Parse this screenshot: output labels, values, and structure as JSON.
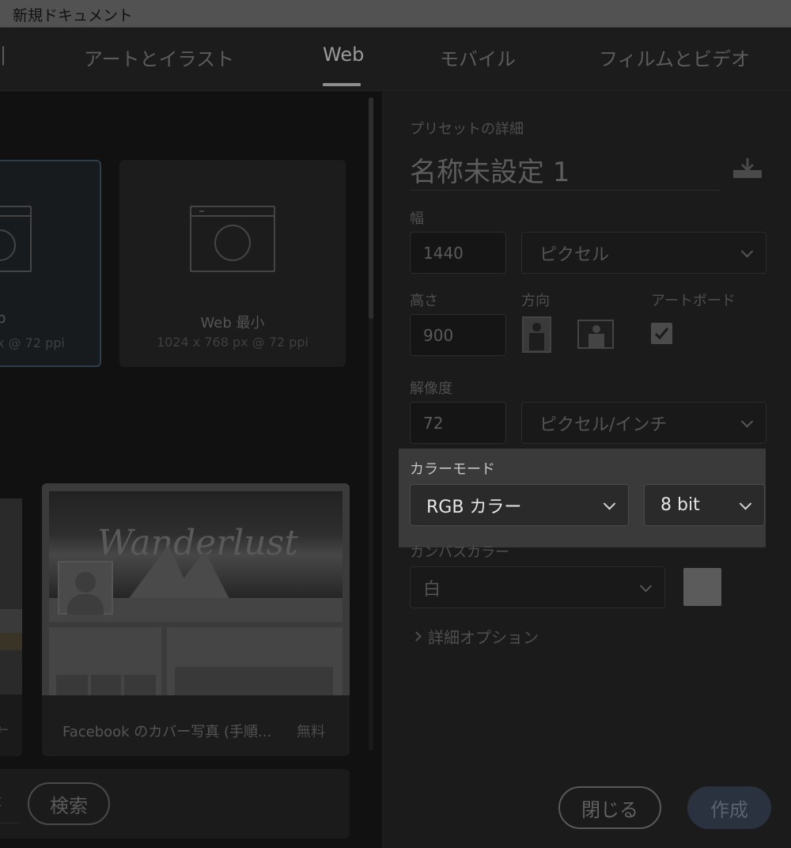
{
  "window": {
    "title": "新規ドキュメント"
  },
  "tabs": [
    {
      "label": "|"
    },
    {
      "label": "アートとイラスト"
    },
    {
      "label": "Web",
      "active": true
    },
    {
      "label": "モバイル"
    },
    {
      "label": "フィルムとビデオ"
    }
  ],
  "presets": [
    {
      "name": "p",
      "size": "x @ 72 ppi",
      "selected": true
    },
    {
      "name": "Web 最小",
      "size": "1024 x 768 px @ 72 ppi"
    }
  ],
  "templates": {
    "left_card_fragment": "←",
    "facebook": {
      "title": "Facebook のカバー写真 (手順...",
      "price": "無料",
      "thumbnail_text": "Wanderlust"
    }
  },
  "search": {
    "button_label": "検索",
    "left_fragment": "t"
  },
  "details": {
    "section_label": "プリセットの詳細",
    "doc_name": "名称未設定 1",
    "width_label": "幅",
    "width_value": "1440",
    "width_unit": "ピクセル",
    "height_label": "高さ",
    "height_value": "900",
    "orientation_label": "方向",
    "artboard_label": "アートボード",
    "artboard_checked": true,
    "resolution_label": "解像度",
    "resolution_value": "72",
    "resolution_unit": "ピクセル/インチ",
    "color_mode_label": "カラーモード",
    "color_mode_value": "RGB カラー",
    "bit_depth_value": "8 bit",
    "canvas_color_label": "カンバスカラー",
    "canvas_color_value": "白",
    "advanced_label": "詳細オプション"
  },
  "actions": {
    "close_label": "閉じる",
    "create_label": "作成"
  },
  "colors": {
    "dim_bg": "#161616",
    "highlight_bg": "#3a3a3a",
    "accent_button": "#2a3240"
  }
}
